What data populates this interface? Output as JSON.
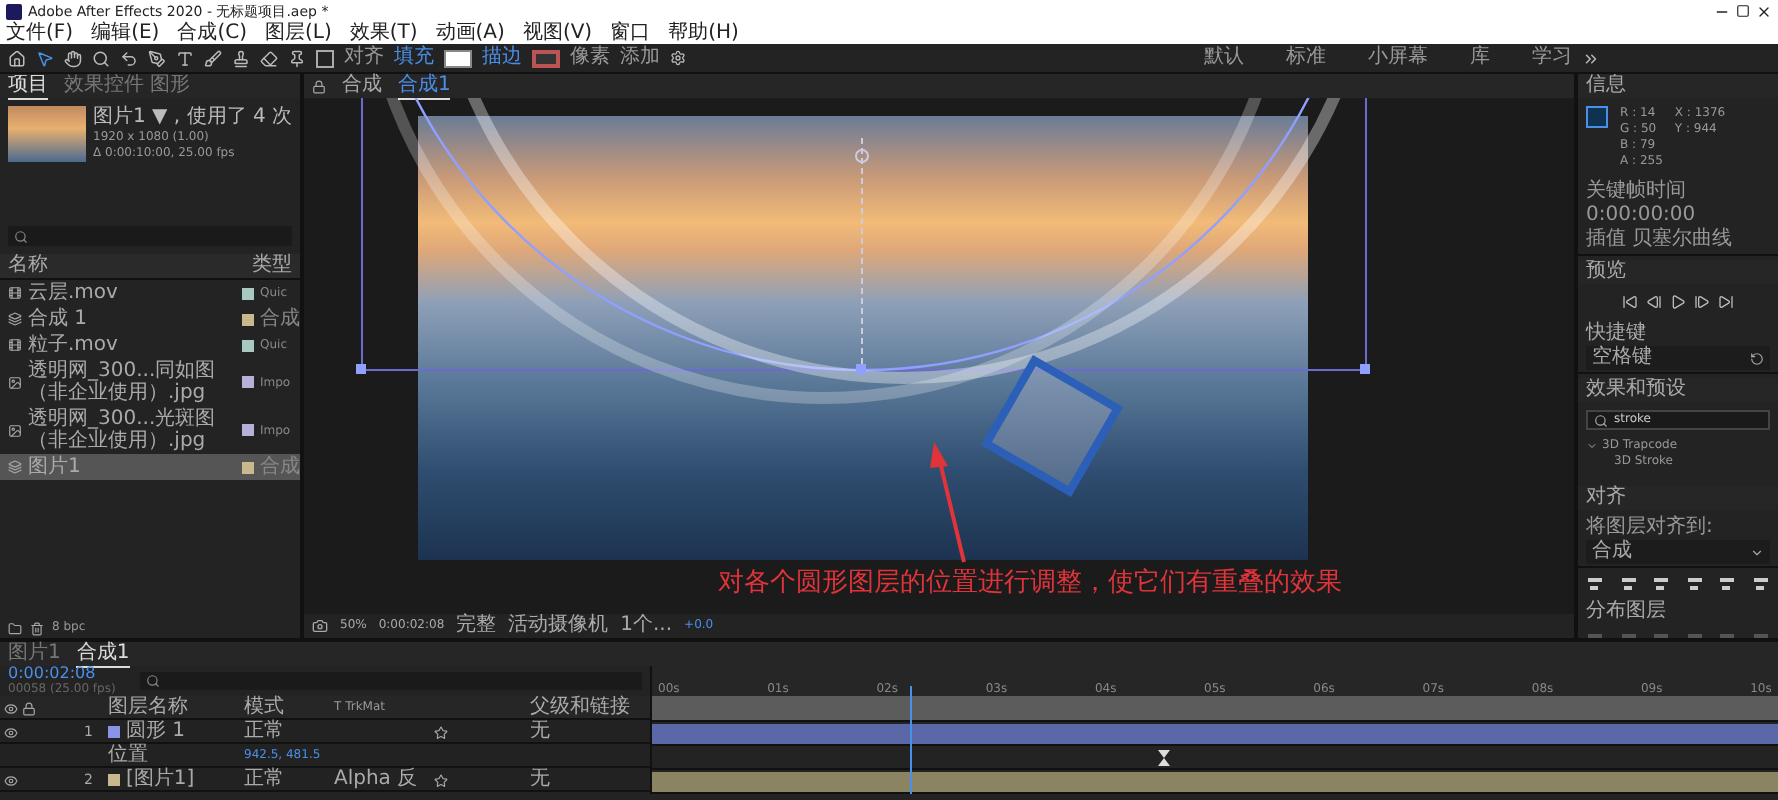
{
  "window": {
    "title": "Adobe After Effects 2020 - 无标题项目.aep *"
  },
  "menu": [
    "文件(F)",
    "编辑(E)",
    "合成(C)",
    "图层(L)",
    "效果(T)",
    "动画(A)",
    "视图(V)",
    "窗口",
    "帮助(H)"
  ],
  "toolbar": {
    "snapping": {
      "label": "对齐",
      "checked": false
    },
    "fill_label": "填充",
    "stroke_label": "描边",
    "stroke_unit": "像素",
    "add_label": "添加"
  },
  "workspaces": [
    "默认",
    "标准",
    "小屏幕",
    "库",
    "学习"
  ],
  "project_panel": {
    "tabs": [
      {
        "label": "项目",
        "selected": true
      },
      {
        "label": "效果控件 图形",
        "selected": false
      }
    ],
    "preview": {
      "name": "图片1 ▼ , 使用了 4 次",
      "size": "1920 x 1080 (1.00)",
      "duration": "Δ 0:00:10:00, 25.00 fps"
    },
    "columns": [
      "名称",
      "类型"
    ],
    "items": [
      {
        "kind": "footage",
        "name": "云层.mov",
        "type": "Quic",
        "color": "#a8c8c0",
        "selected": false
      },
      {
        "kind": "comp",
        "name": "合成 1",
        "type": "合成",
        "color": "#c8b98c",
        "selected": false
      },
      {
        "kind": "footage",
        "name": "粒子.mov",
        "type": "Quic",
        "color": "#a8c8c0",
        "selected": false
      },
      {
        "kind": "image",
        "name": "透明网_300...同如图（非企业使用）.jpg",
        "type": "Impo",
        "color": "#b8b0d8",
        "selected": false
      },
      {
        "kind": "image",
        "name": "透明网_300...光斑图（非企业使用）.jpg",
        "type": "Impo",
        "color": "#b8b0d8",
        "selected": false
      },
      {
        "kind": "comp",
        "name": "图片1",
        "type": "合成",
        "color": "#c8b98c",
        "selected": true
      }
    ],
    "bit_depth": "8 bpc"
  },
  "viewer": {
    "tab_prefix": "合成",
    "tabs": [
      {
        "label": "合成1",
        "selected": true
      }
    ],
    "caption": "对各个圆形图层的位置进行调整，使它们有重叠的效果",
    "zoom": "50%",
    "time": "0:00:02:08",
    "resolution": "完整",
    "camera": "活动摄像机",
    "views": "1个...",
    "exposure": "+0.0"
  },
  "info_panel": {
    "title": "信息",
    "color_values": [
      "R : 14",
      "G : 50",
      "B : 79",
      "A : 255"
    ],
    "position_values": [
      "X : 1376",
      "Y : 944"
    ],
    "keyframe_time": "关键帧时间 0:00:00:00",
    "interpolation": "插值 贝塞尔曲线"
  },
  "preview_panel": {
    "title": "预览",
    "shortcut_label": "快捷键",
    "shortcut": "空格键"
  },
  "effects_panel": {
    "title": "效果和预设",
    "search": "stroke",
    "tree": [
      {
        "name": "3D Trapcode",
        "expanded": true,
        "children": [
          {
            "name": "3D Stroke"
          }
        ]
      }
    ]
  },
  "align_panel": {
    "title": "对齐",
    "align_to_label": "将图层对齐到:",
    "align_to": "合成",
    "distribute_label": "分布图层"
  },
  "timeline": {
    "tabs": [
      {
        "label": "图片1",
        "selected": false
      },
      {
        "label": "合成1",
        "selected": true
      }
    ],
    "current_time": "0:00:02:08",
    "frame_info": "00058 (25.00 fps)",
    "columns": [
      "图层名称",
      "模式",
      "T  TrkMat",
      "父级和链接"
    ],
    "layers": [
      {
        "kind": "layer",
        "number": "1",
        "name": "圆形 1",
        "mode": "正常",
        "parent": "无",
        "color": "#8b93e8"
      },
      {
        "kind": "property",
        "name": "位置",
        "value": "942.5, 481.5"
      },
      {
        "kind": "layer",
        "number": "2",
        "name": "[图片1]",
        "mode": "正常",
        "trkmat": "Alpha 反",
        "parent": "无",
        "color": "#c8b98c"
      }
    ],
    "ruler": [
      "00s",
      "01s",
      "02s",
      "03s",
      "04s",
      "05s",
      "06s",
      "07s",
      "08s",
      "09s",
      "10s"
    ],
    "playhead": {
      "level": 0.23
    }
  }
}
